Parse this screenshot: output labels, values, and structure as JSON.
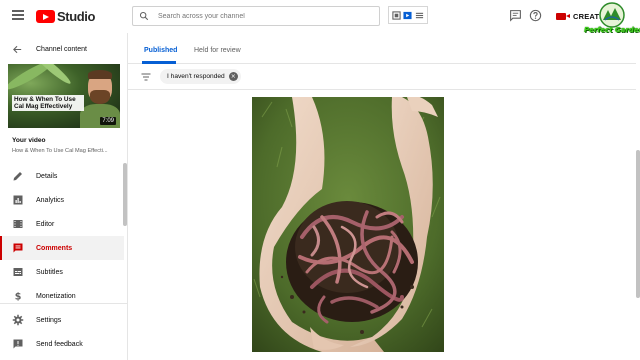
{
  "header": {
    "logo_text": "Studio",
    "search_placeholder": "Search across your channel",
    "create_label": "CREATE",
    "watermark_text": "Perfect Gardens",
    "icons": [
      "menu-icon",
      "search-icon",
      "feedback-icon",
      "help-icon",
      "camera-icon"
    ]
  },
  "sidebar": {
    "back_label": "Channel content",
    "thumbnail": {
      "title": "How & When To Use Cal Mag Effectively",
      "duration": "7:09"
    },
    "your_video_label": "Your video",
    "video_name": "How & When To Use Cal Mag Effecti...",
    "nav": [
      {
        "label": "Details",
        "icon": "pencil-icon",
        "active": false
      },
      {
        "label": "Analytics",
        "icon": "analytics-icon",
        "active": false
      },
      {
        "label": "Editor",
        "icon": "film-icon",
        "active": false
      },
      {
        "label": "Comments",
        "icon": "comment-icon",
        "active": true
      },
      {
        "label": "Subtitles",
        "icon": "subtitles-icon",
        "active": false
      },
      {
        "label": "Monetization",
        "icon": "dollar-icon",
        "active": false
      }
    ],
    "bottom_nav": [
      {
        "label": "Settings",
        "icon": "gear-icon"
      },
      {
        "label": "Send feedback",
        "icon": "feedback-icon"
      }
    ]
  },
  "main": {
    "tabs": [
      {
        "label": "Published",
        "active": true
      },
      {
        "label": "Held for review",
        "active": false
      }
    ],
    "filter_chip": "I haven't responded"
  },
  "colors": {
    "accent": "#065fd4",
    "active_red": "#cc0000",
    "brand_red": "#ff0000"
  }
}
